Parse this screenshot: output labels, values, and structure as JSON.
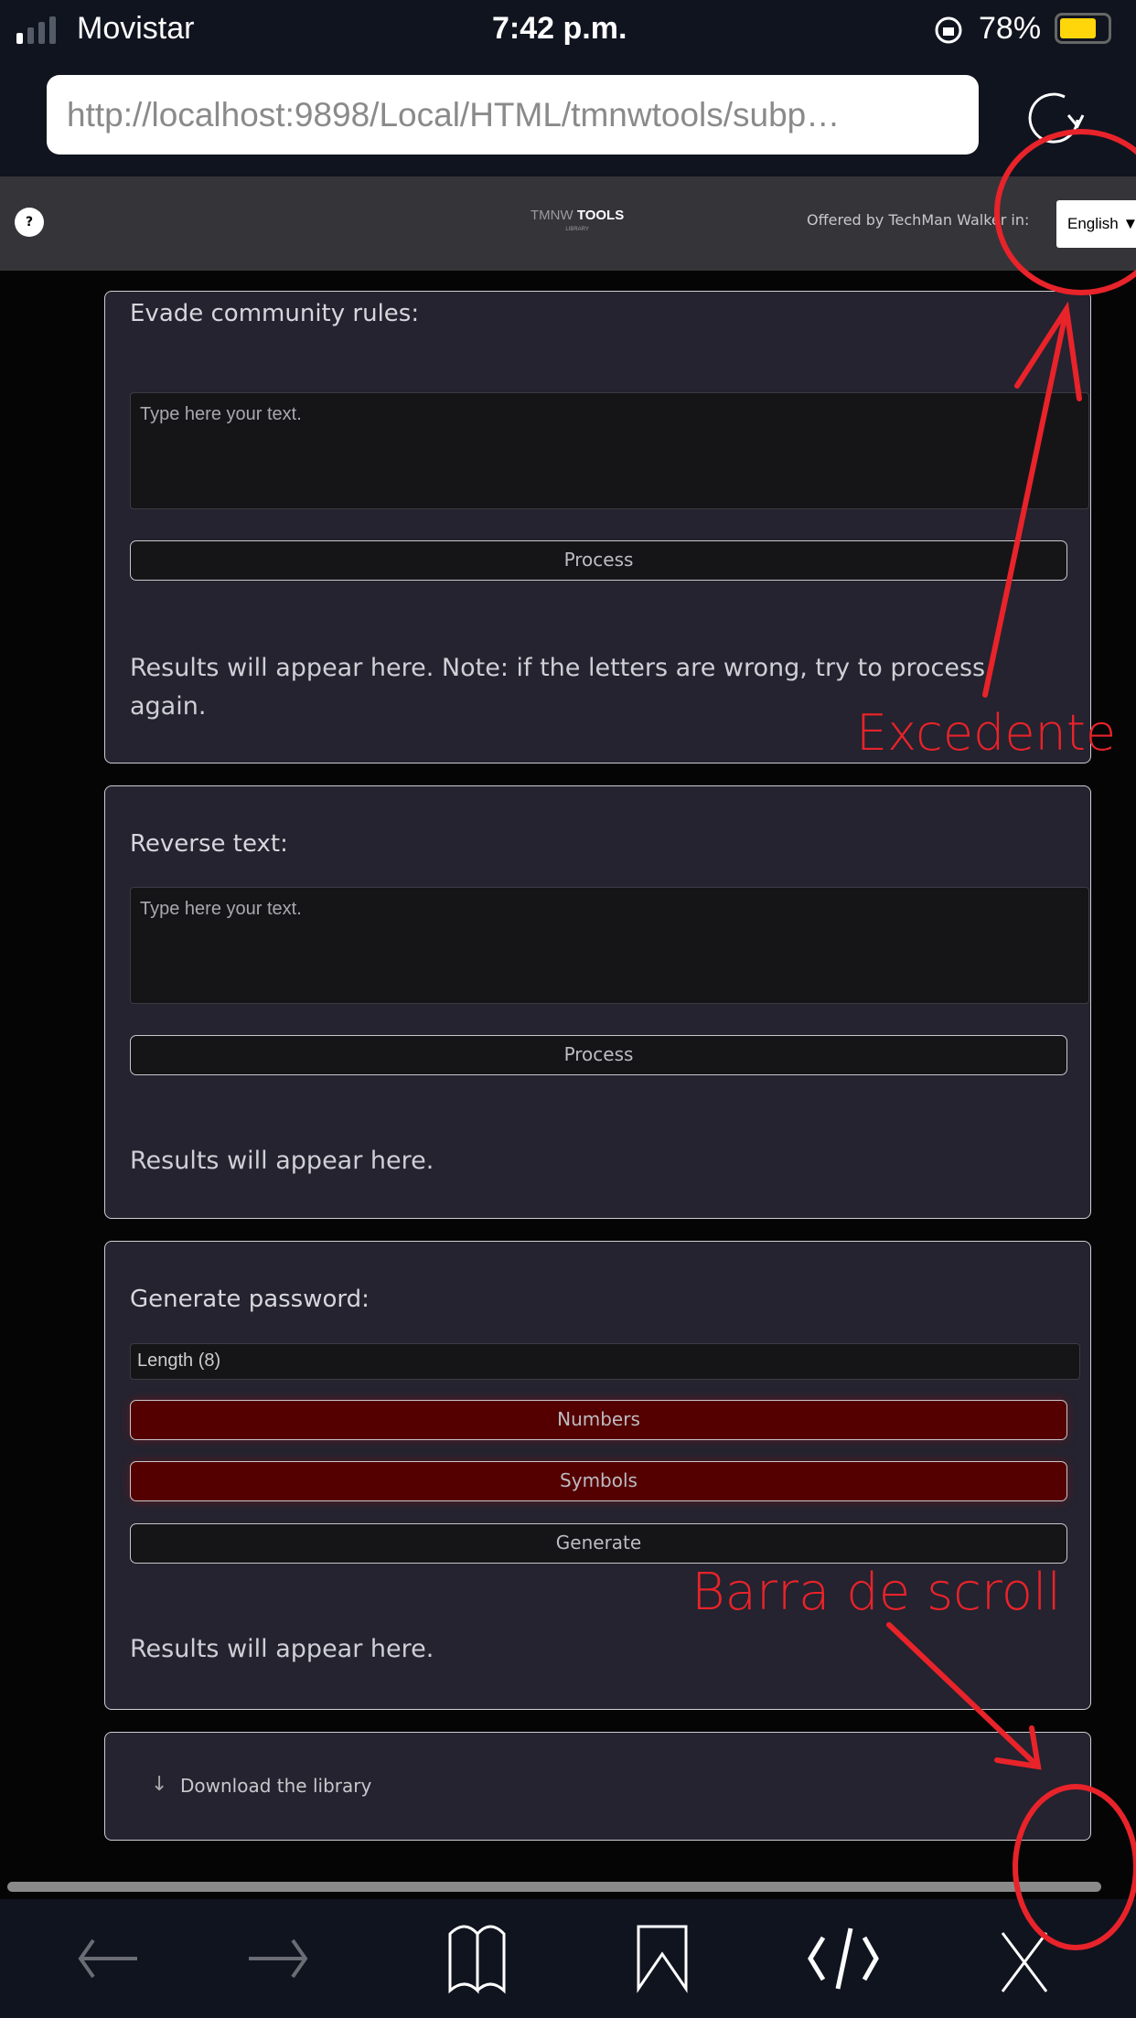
{
  "status_bar": {
    "carrier": "Movistar",
    "time": "7:42 p.m.",
    "battery": "78%",
    "battery_level": 0.78,
    "battery_color": "#ffd60a"
  },
  "browser": {
    "url": "http://localhost:9898/Local/HTML/tmnwtools/subp…",
    "reload_icon": "reload-icon"
  },
  "header": {
    "help_label": "?",
    "logo_prefix": "TMNW",
    "logo_main": "TOOLS",
    "logo_sub": "LIBRARY",
    "offered_by": "Offered by TechMan Walker in:",
    "language": "English"
  },
  "cards": [
    {
      "title": "Evade community rules:",
      "placeholder": "Type here your text.",
      "button": "Process",
      "result": "Results will appear here. Note: if the letters are wrong, try to process again."
    },
    {
      "title": "Reverse text:",
      "placeholder": "Type here your text.",
      "button": "Process",
      "result": "Results will appear here."
    },
    {
      "title": "Generate password:",
      "length_label": "Length (8)",
      "numbers": "Numbers",
      "symbols": "Symbols",
      "generate": "Generate",
      "result": "Results will appear here.",
      "toggle_active_color": "#540000"
    }
  ],
  "download": {
    "icon": "arrow-down-icon",
    "label": "Download the library"
  },
  "annotations": {
    "overflow_label": "Excedente",
    "scrollbar_label": "Barra de scroll",
    "color": "#e8232a"
  },
  "toolbar": {
    "icons": [
      "back-icon",
      "forward-icon",
      "book-icon",
      "bookmark-icon",
      "code-icon",
      "close-icon"
    ]
  }
}
